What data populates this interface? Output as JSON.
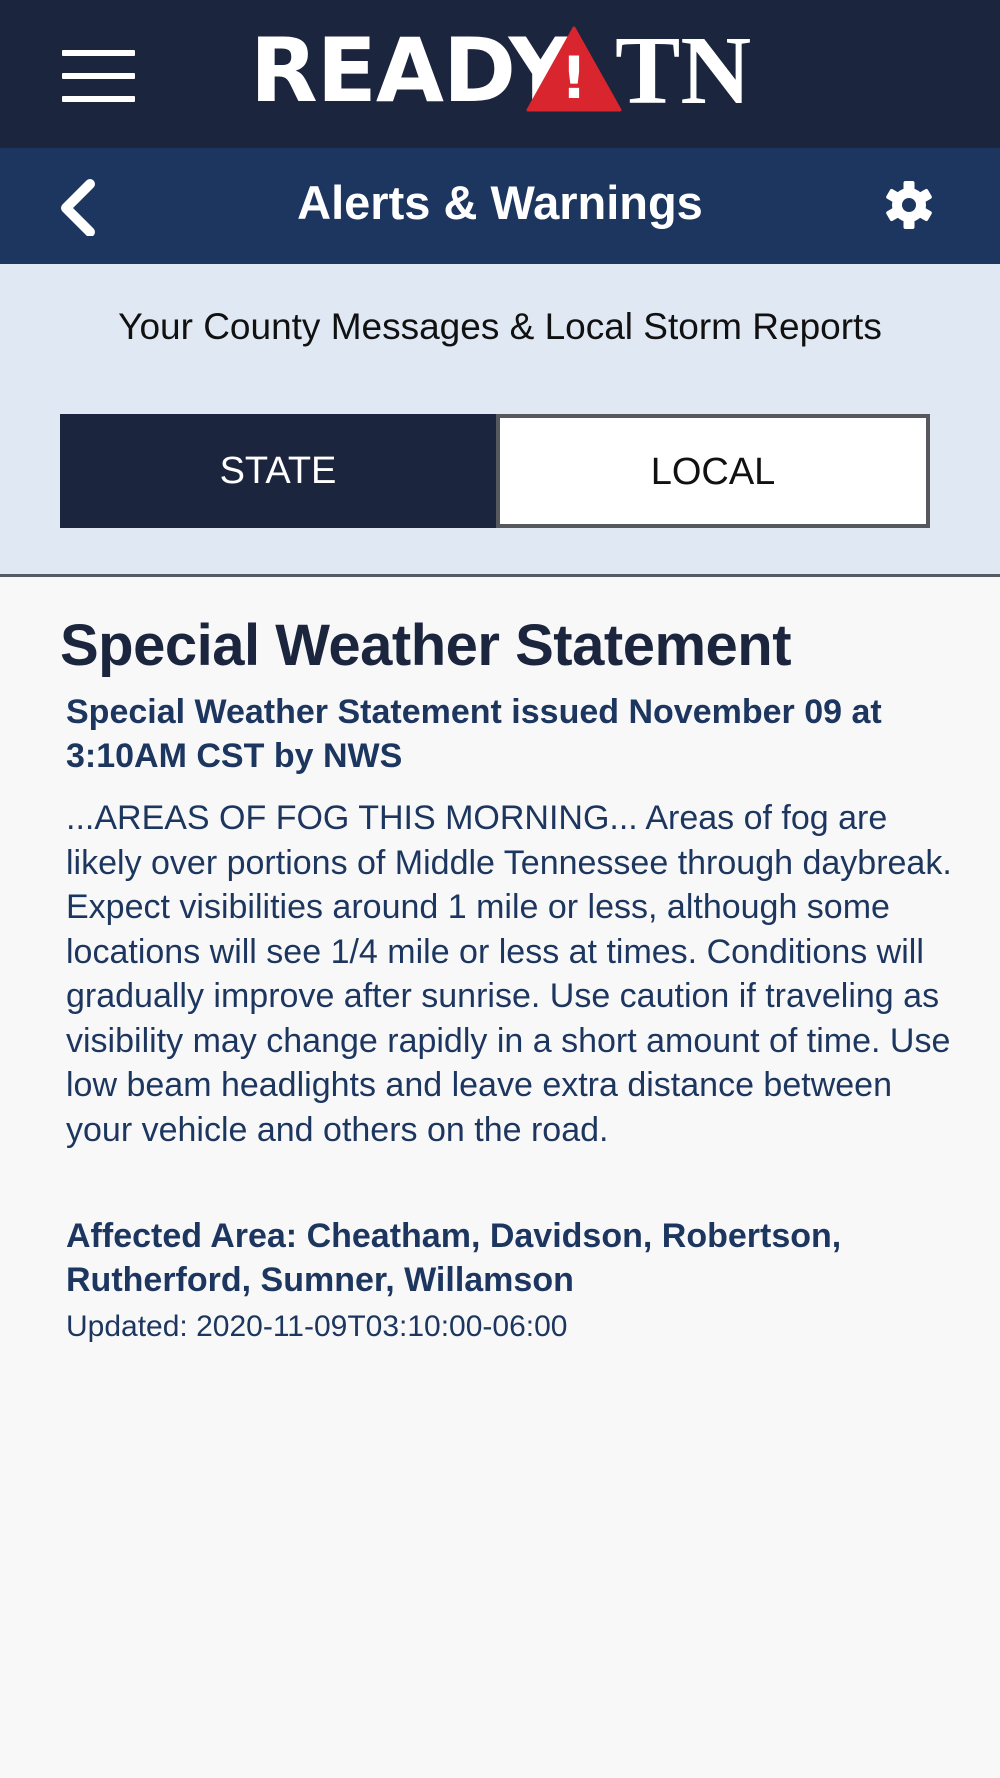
{
  "brand": {
    "logo_word_left": "READY",
    "logo_word_right": "TN",
    "logo_alert_mark": "!",
    "colors": {
      "topbar": "#1b253d",
      "navbar": "#1d365f",
      "logo_triangle": "#d9252d",
      "panel": "#dfe8f3"
    }
  },
  "header": {
    "menu_icon": "hamburger-menu-icon",
    "back_icon": "chevron-left-icon",
    "title": "Alerts & Warnings",
    "settings_icon": "gear-icon"
  },
  "filter": {
    "subtitle": "Your County Messages & Local Storm Reports",
    "tabs": [
      {
        "label": "STATE",
        "selected": true
      },
      {
        "label": "LOCAL",
        "selected": false
      }
    ]
  },
  "alert": {
    "heading": "Special Weather Statement",
    "subheading": "Special Weather Statement issued November 09 at 3:10AM CST by NWS",
    "body": "...AREAS OF FOG THIS MORNING... Areas of fog are likely over portions of Middle Tennessee through daybreak. Expect visibilities around 1 mile or less, although some locations will see 1/4 mile or less at times. Conditions will gradually improve after sunrise. Use caution if traveling as visibility may change rapidly in a short amount of time. Use low beam headlights and leave extra distance between your vehicle and others on the road.",
    "affected_area": "Affected Area: Cheatham, Davidson, Robertson, Rutherford, Sumner, Willamson",
    "updated": "Updated: 2020-11-09T03:10:00-06:00"
  }
}
